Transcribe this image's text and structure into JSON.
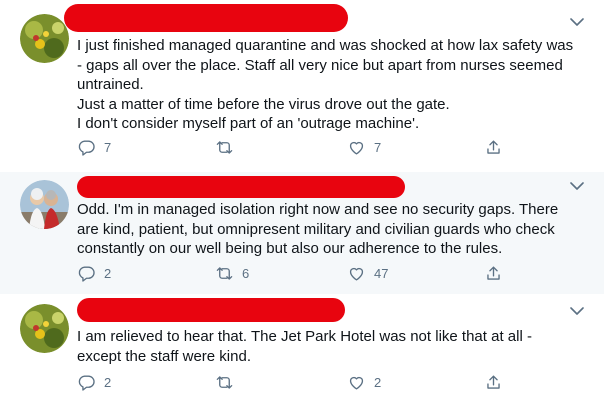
{
  "tweets": [
    {
      "lines": [
        "I just finished managed quarantine and was shocked at how lax safety was",
        "- gaps all over the place. Staff all very nice but apart from nurses seemed",
        "untrained.",
        "Just a matter of time before the virus drove out the gate.",
        "I don't consider myself part of an 'outrage machine'."
      ],
      "reply_count": "7",
      "retweet_count": "",
      "like_count": "7"
    },
    {
      "lines": [
        "Odd. I'm in managed isolation right now and see no security gaps. There",
        "are kind, patient, but omnipresent military and civilian guards who check",
        "constantly on our well being but also our adherence to the rules."
      ],
      "reply_count": "2",
      "retweet_count": "6",
      "like_count": "47"
    },
    {
      "lines": [
        "I am relieved to hear that. The Jet Park Hotel was not like that at all -",
        "except the staff were kind."
      ],
      "reply_count": "2",
      "retweet_count": "",
      "like_count": "2"
    }
  ],
  "colors": {
    "redaction": "#e8040f",
    "icon_gray": "#5b7083",
    "separator": "#e6ecf0",
    "highlight_bg": "#f5f8fa"
  },
  "icons": [
    "chevron-down-icon",
    "reply-icon",
    "retweet-icon",
    "like-icon",
    "share-icon"
  ]
}
